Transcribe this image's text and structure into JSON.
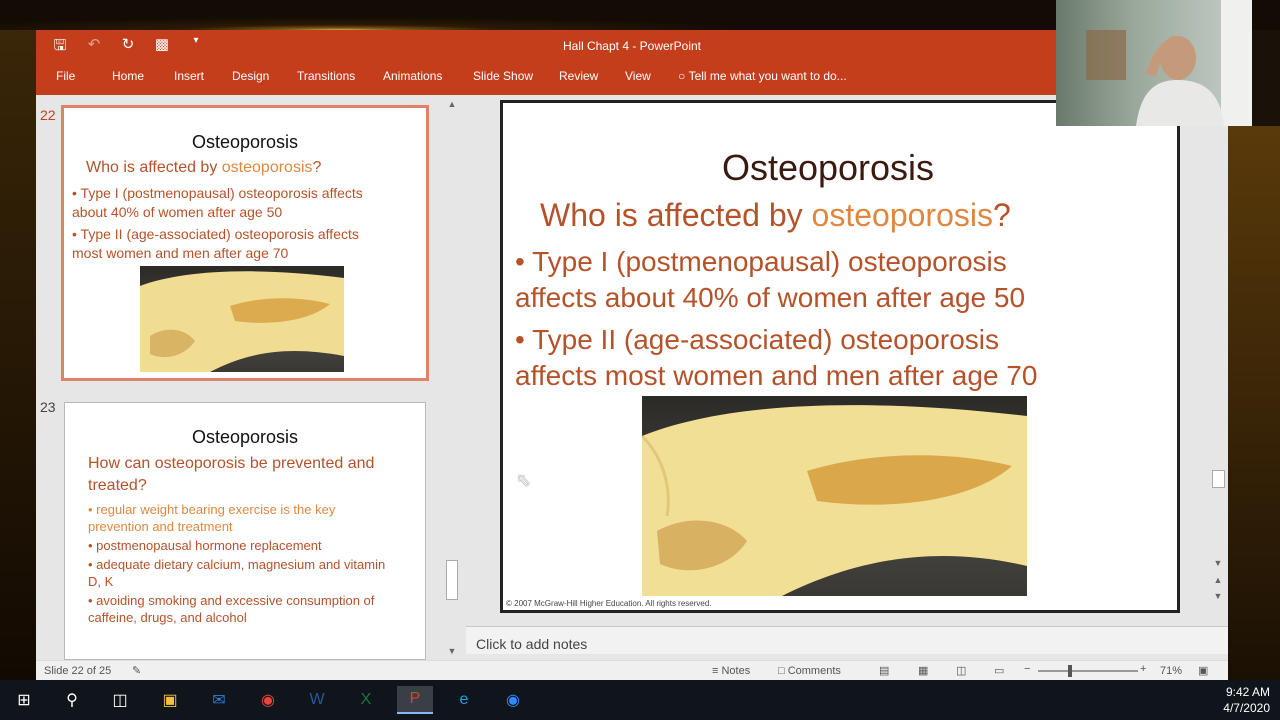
{
  "window": {
    "title": "Hall Chapt 4 - PowerPoint"
  },
  "ribbon": {
    "tabs": [
      "File",
      "Home",
      "Insert",
      "Design",
      "Transitions",
      "Animations",
      "Slide Show",
      "Review",
      "View"
    ],
    "tell_me": "Tell me what you want to do..."
  },
  "thumbnails": [
    {
      "number": "22",
      "title": "Osteoporosis",
      "subtitle_prefix": "Who is affected by ",
      "subtitle_highlight": "osteoporosis",
      "subtitle_suffix": "?",
      "bullets": [
        "• Type I (postmenopausal) osteoporosis affects about 40% of women after age 50",
        "• Type II (age-associated) osteoporosis affects most women and men after age 70"
      ]
    },
    {
      "number": "23",
      "title": "Osteoporosis",
      "subtitle": "How can osteoporosis be prevented and treated?",
      "bullets": [
        "• regular weight bearing exercise is the  key prevention and treatment",
        "• postmenopausal hormone replacement",
        "• adequate dietary calcium, magnesium and vitamin D, K",
        "• avoiding smoking and excessive consumption of caffeine, drugs, and alcohol"
      ]
    }
  ],
  "slide": {
    "title": "Osteoporosis",
    "subtitle_prefix": "Who is affected by ",
    "subtitle_highlight": "osteoporosis",
    "subtitle_suffix": "?",
    "bullet1_line1": "• Type I (postmenopausal) osteoporosis",
    "bullet1_line2": "affects about 40% of women after age 50",
    "bullet2_line1": "• Type II (age-associated) osteoporosis",
    "bullet2_line2": "affects most women and men after age 70",
    "copyright": "© 2007 McGraw-Hill Higher Education.  All rights reserved."
  },
  "notes": {
    "placeholder": "Click to add notes"
  },
  "status": {
    "slide_indicator": "Slide 22 of 25",
    "notes_label": "Notes",
    "comments_label": "Comments",
    "zoom": "71%"
  },
  "taskbar": {
    "time": "9:42 AM",
    "date": "4/7/2020",
    "apps": [
      "start",
      "search",
      "task-view",
      "file-explorer",
      "outlook",
      "chrome",
      "word",
      "excel",
      "powerpoint",
      "internet-explorer",
      "zoom"
    ]
  },
  "colors": {
    "accent": "#c43e1c",
    "slide_orange": "#b5522a",
    "slide_highlight": "#e0873f"
  }
}
